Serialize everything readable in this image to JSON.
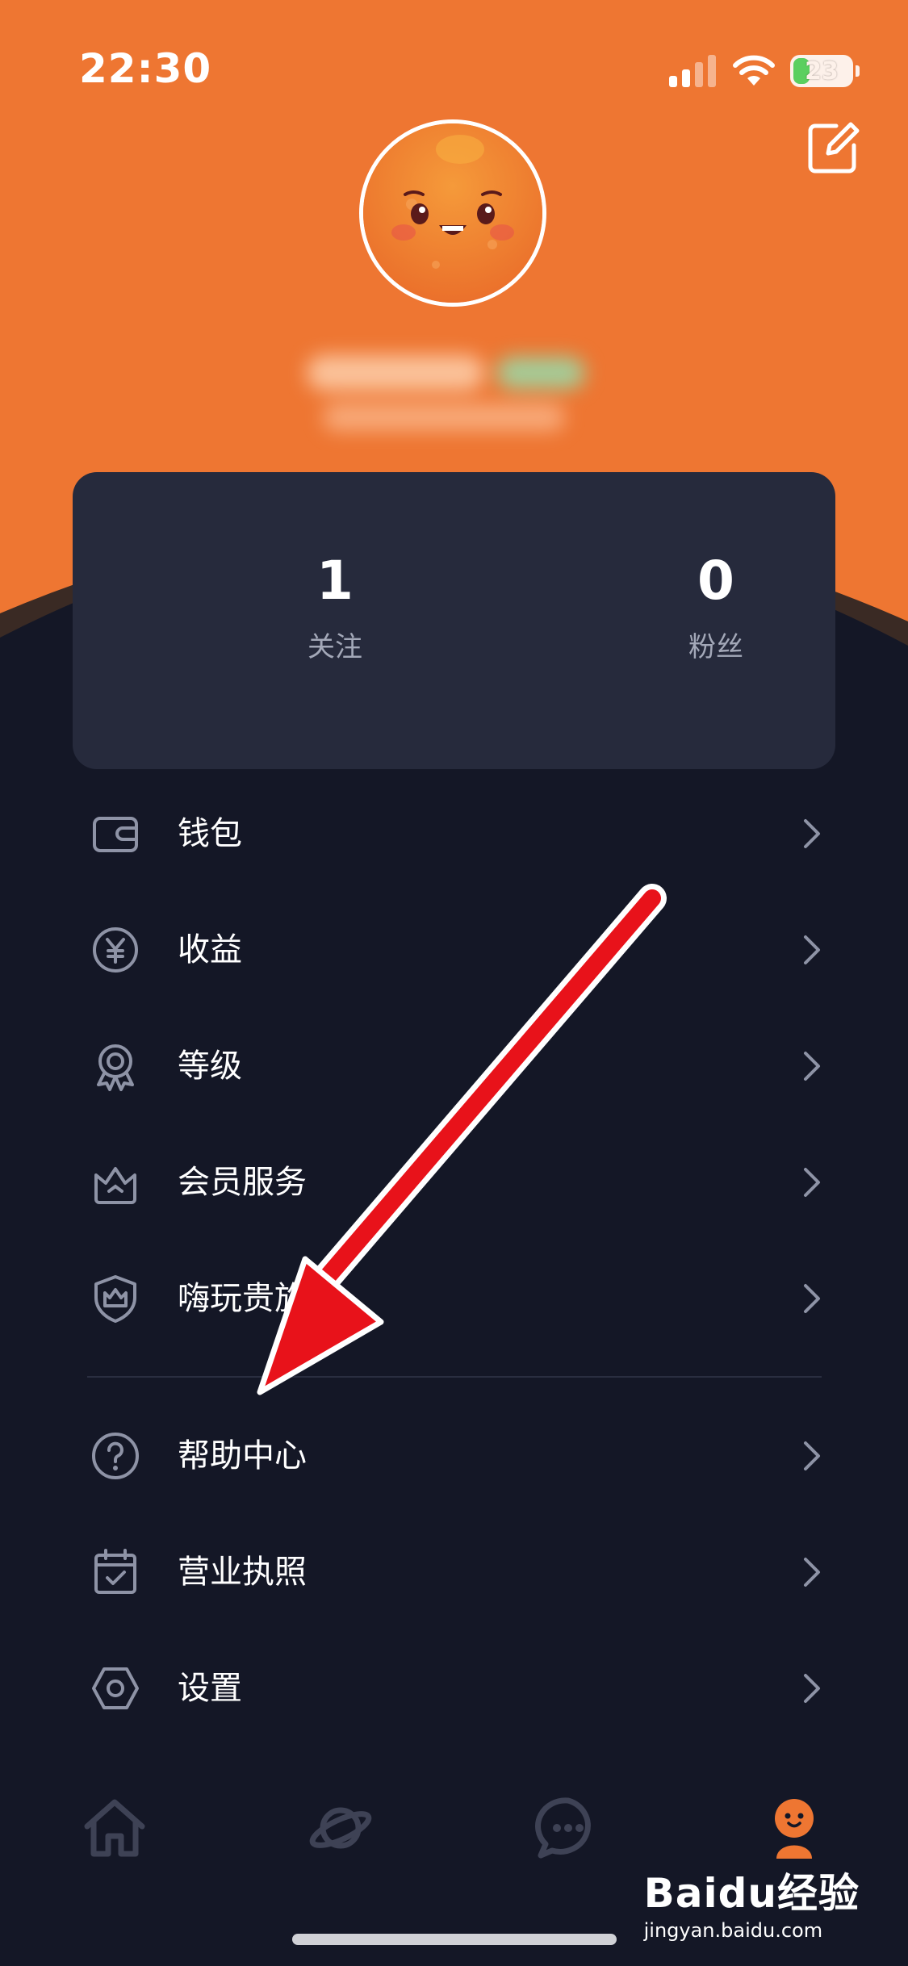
{
  "status_bar": {
    "time": "22:30",
    "battery": "23",
    "icons": [
      "signal-icon",
      "wifi-icon",
      "battery-icon"
    ]
  },
  "header": {
    "edit_icon": "edit-icon",
    "accent_color": "#ee7632",
    "background_color": "#141726"
  },
  "stats": {
    "following_value": "1",
    "following_label": "关注",
    "fans_value": "0",
    "fans_label": "粉丝"
  },
  "menu": {
    "items": [
      {
        "label": "钱包",
        "icon": "wallet-icon"
      },
      {
        "label": "收益",
        "icon": "yen-coin-icon"
      },
      {
        "label": "等级",
        "icon": "medal-icon"
      },
      {
        "label": "会员服务",
        "icon": "crown-icon"
      },
      {
        "label": "嗨玩贵族",
        "icon": "shield-crown-icon"
      },
      {
        "label": "帮助中心",
        "icon": "help-icon"
      },
      {
        "label": "营业执照",
        "icon": "calendar-check-icon"
      },
      {
        "label": "设置",
        "icon": "hexagon-settings-icon"
      }
    ]
  },
  "tab_bar": {
    "tabs": [
      {
        "icon": "home-icon",
        "active": false
      },
      {
        "icon": "planet-icon",
        "active": false
      },
      {
        "icon": "chat-icon",
        "active": false
      },
      {
        "icon": "profile-mascot-icon",
        "active": true
      }
    ],
    "active_color": "#ee7632",
    "inactive_color": "#3e4255"
  },
  "watermark": {
    "brand": "Baidu经验",
    "url": "jingyan.baidu.com"
  }
}
